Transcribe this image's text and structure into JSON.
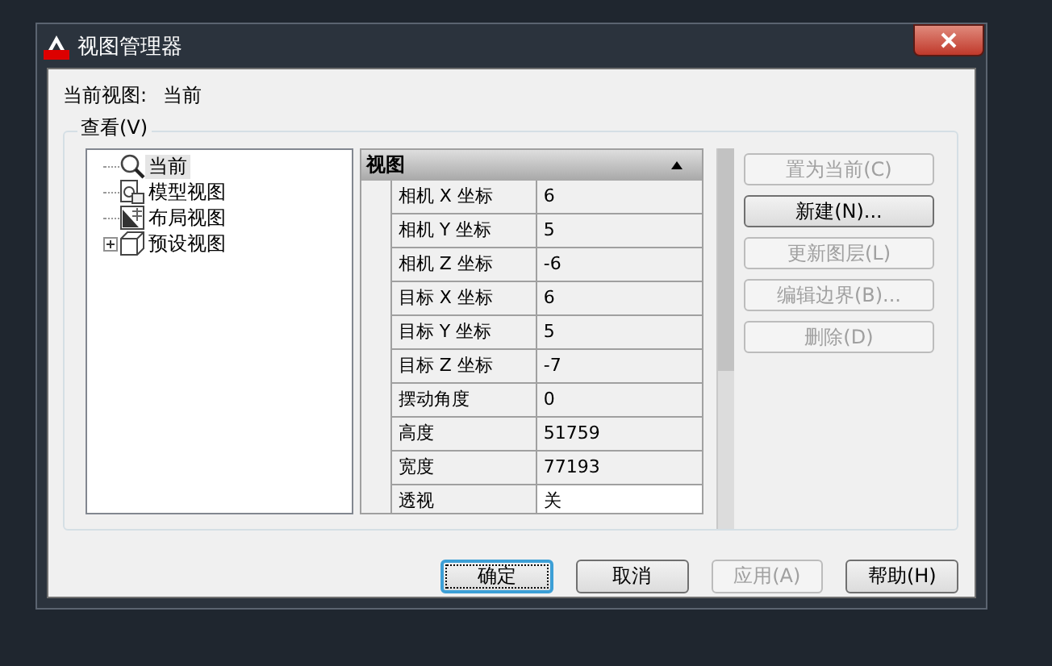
{
  "window": {
    "title": "视图管理器"
  },
  "current_view": {
    "label": "当前视图:",
    "value": "当前"
  },
  "group": {
    "label": "查看(V)"
  },
  "tree": [
    {
      "label": "当前",
      "kind": "current",
      "selected": true
    },
    {
      "label": "模型视图",
      "kind": "model",
      "selected": false
    },
    {
      "label": "布局视图",
      "kind": "layout",
      "selected": false
    },
    {
      "label": "预设视图",
      "kind": "preset",
      "selected": false,
      "expanded": false
    }
  ],
  "properties": {
    "section": "视图",
    "expanded": true,
    "rows": [
      {
        "name": "相机 X 坐标",
        "value": "6",
        "editable": false
      },
      {
        "name": "相机 Y 坐标",
        "value": "5",
        "editable": false
      },
      {
        "name": "相机 Z 坐标",
        "value": "-6",
        "editable": false
      },
      {
        "name": "目标 X 坐标",
        "value": "6",
        "editable": false
      },
      {
        "name": "目标 Y 坐标",
        "value": "5",
        "editable": false
      },
      {
        "name": "目标 Z 坐标",
        "value": "-7",
        "editable": false
      },
      {
        "name": "摆动角度",
        "value": "0",
        "editable": false
      },
      {
        "name": "高度",
        "value": "51759",
        "editable": false
      },
      {
        "name": "宽度",
        "value": "77193",
        "editable": false
      },
      {
        "name": "透视",
        "value": "关",
        "editable": true
      }
    ]
  },
  "side_buttons": [
    {
      "label": "置为当前(C)",
      "disabled": true
    },
    {
      "label": "新建(N)...",
      "disabled": false
    },
    {
      "label": "更新图层(L)",
      "disabled": true
    },
    {
      "label": "编辑边界(B)...",
      "disabled": true
    },
    {
      "label": "删除(D)",
      "disabled": true
    }
  ],
  "bottom_buttons": [
    {
      "label": "确定",
      "disabled": false,
      "default": true
    },
    {
      "label": "取消",
      "disabled": false,
      "default": false
    },
    {
      "label": "应用(A)",
      "disabled": true,
      "default": false
    },
    {
      "label": "帮助(H)",
      "disabled": false,
      "default": false
    }
  ]
}
